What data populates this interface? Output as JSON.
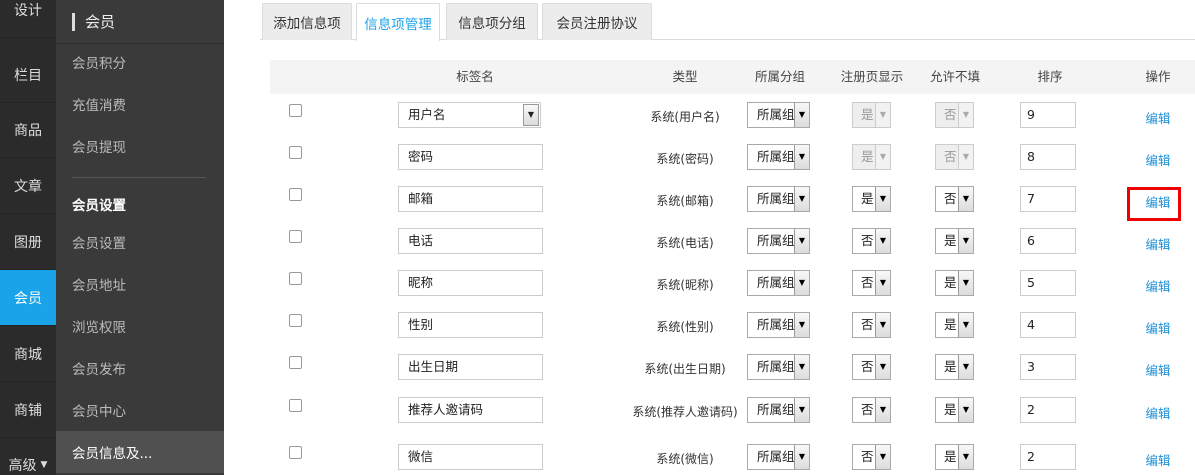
{
  "rail": {
    "items": [
      {
        "label": "设计",
        "active": false
      },
      {
        "label": "栏目",
        "active": false
      },
      {
        "label": "商品",
        "active": false
      },
      {
        "label": "文章",
        "active": false
      },
      {
        "label": "图册",
        "active": false
      },
      {
        "label": "会员",
        "active": true
      },
      {
        "label": "商城",
        "active": false
      },
      {
        "label": "商铺",
        "active": false
      },
      {
        "label": "高级",
        "active": false,
        "caret": "▼"
      }
    ]
  },
  "subnav": {
    "title": "会员",
    "items": [
      {
        "label": "会员积分"
      },
      {
        "label": "充值消费"
      },
      {
        "label": "会员提现"
      },
      {
        "label": "会员设置",
        "heading": true
      },
      {
        "label": "会员设置"
      },
      {
        "label": "会员地址"
      },
      {
        "label": "浏览权限"
      },
      {
        "label": "会员发布"
      },
      {
        "label": "会员中心"
      },
      {
        "label": "会员信息及...",
        "active": true
      }
    ]
  },
  "tabs": [
    {
      "label": "添加信息项",
      "active": false
    },
    {
      "label": "信息项管理",
      "active": true
    },
    {
      "label": "信息项分组",
      "active": false
    },
    {
      "label": "会员注册协议",
      "active": false
    }
  ],
  "table": {
    "headers": [
      "标签名",
      "类型",
      "所属分组",
      "注册页显示",
      "允许不填",
      "排序",
      "操作"
    ],
    "group_placeholder": "所属组",
    "edit_label": "编辑",
    "rows": [
      {
        "name": "用户名",
        "name_select": true,
        "type": "系统(用户名)",
        "reg": "是",
        "allow": "否",
        "disabled": true,
        "order": "9"
      },
      {
        "name": "密码",
        "type": "系统(密码)",
        "reg": "是",
        "allow": "否",
        "disabled": true,
        "order": "8"
      },
      {
        "name": "邮箱",
        "type": "系统(邮箱)",
        "reg": "是",
        "allow": "否",
        "order": "7",
        "highlight": true
      },
      {
        "name": "电话",
        "type": "系统(电话)",
        "reg": "否",
        "allow": "是",
        "order": "6"
      },
      {
        "name": "昵称",
        "type": "系统(昵称)",
        "reg": "否",
        "allow": "是",
        "order": "5"
      },
      {
        "name": "性别",
        "type": "系统(性别)",
        "reg": "否",
        "allow": "是",
        "order": "4"
      },
      {
        "name": "出生日期",
        "type": "系统(出生日期)",
        "reg": "否",
        "allow": "是",
        "order": "3"
      },
      {
        "name": "推荐人邀请码",
        "type": "系统(推荐人邀请码)",
        "reg": "否",
        "allow": "是",
        "order": "2"
      },
      {
        "name": "微信",
        "type": "系统(微信)",
        "reg": "否",
        "allow": "是",
        "order": "2"
      }
    ]
  },
  "colors": {
    "accent": "#1aa3e8",
    "link": "#1e8fd6",
    "highlight": "#e00000"
  }
}
